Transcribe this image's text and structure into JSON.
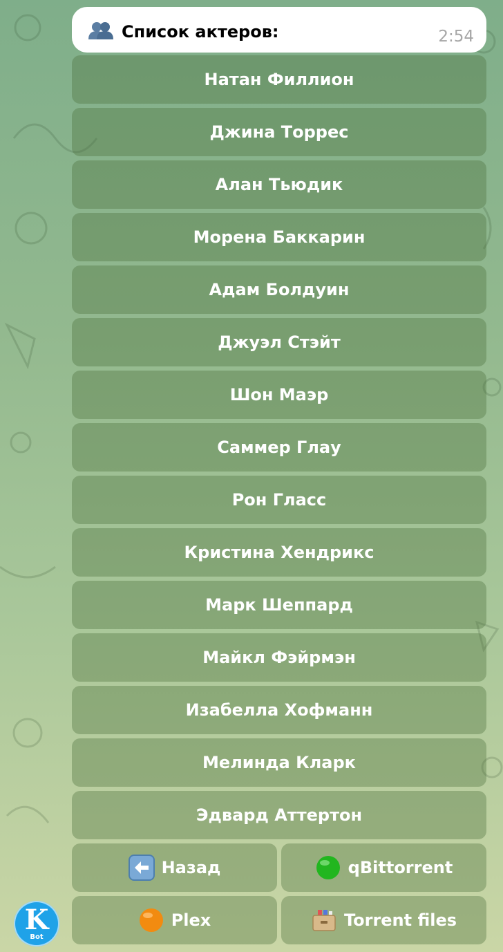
{
  "message": {
    "icon": "busts-in-silhouette-icon",
    "text": "Список актеров:",
    "time": "2:54"
  },
  "actors": [
    "Натан Филлион",
    "Джина Торрес",
    "Алан Тьюдик",
    "Морена Баккарин",
    "Адам Болдуин",
    "Джуэл Стэйт",
    "Шон Маэр",
    "Саммер Глау",
    "Рон Гласс",
    "Кристина Хендрикс",
    "Марк Шеппард",
    "Майкл Фэйрмэн",
    "Изабелла Хофманн",
    "Мелинда Кларк",
    "Эдвард Аттертон"
  ],
  "nav": {
    "back_label": "Назад",
    "back_icon": "left-arrow-icon",
    "qbittorrent_label": "qBittorrent",
    "qbittorrent_icon": "green-circle-icon",
    "plex_label": "Plex",
    "plex_icon": "orange-circle-icon",
    "torrent_files_label": "Torrent files",
    "torrent_files_icon": "card-file-box-icon"
  },
  "avatar": {
    "letter": "K",
    "sub": "Bot"
  },
  "colors": {
    "button_bg": "#6e8f5c",
    "message_bg": "#ffffff",
    "time": "#a6a6a6",
    "avatar": "#1fa2e8"
  }
}
